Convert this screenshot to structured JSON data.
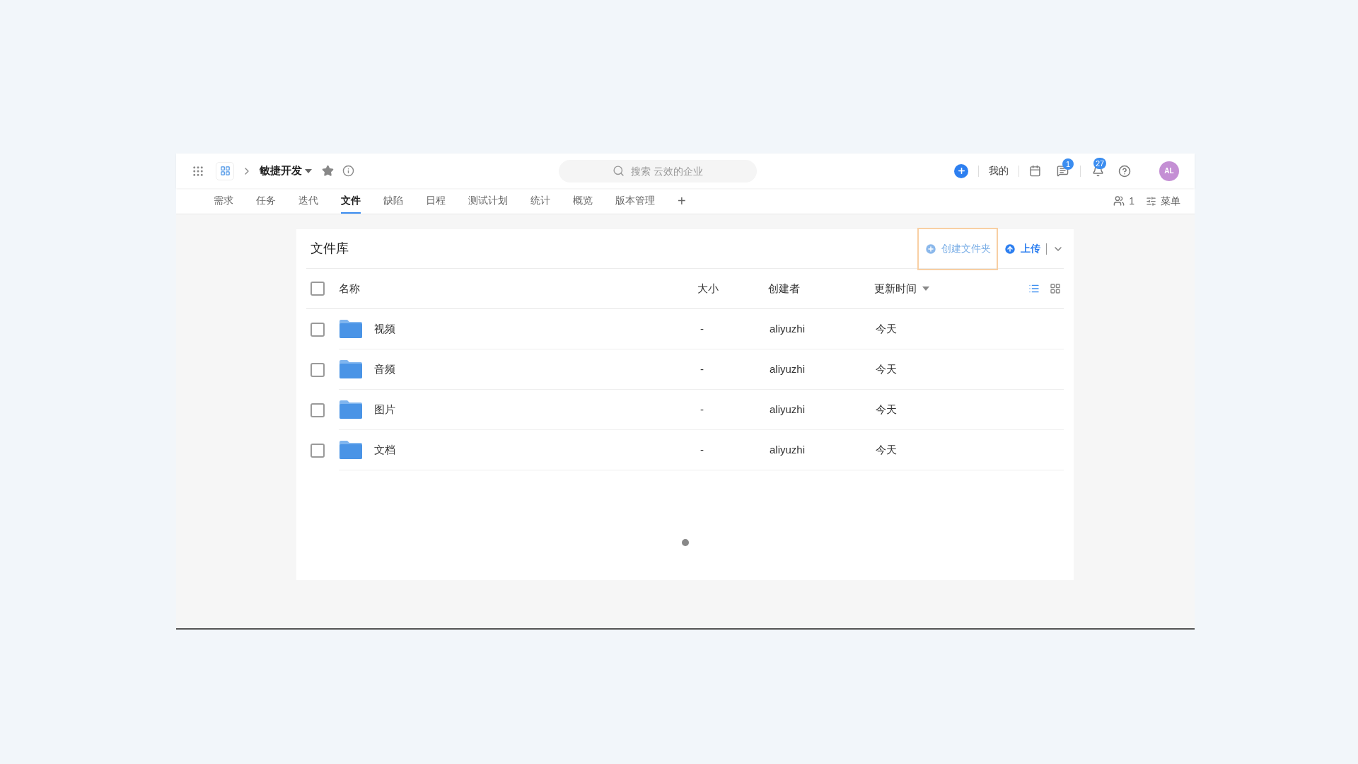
{
  "topbar": {
    "project": "敏捷开发",
    "search": {
      "placeholder": "搜索 云效的企业"
    },
    "mine": "我的",
    "message_badge": "1",
    "notification_badge": "27",
    "avatar": "AL"
  },
  "tabs": [
    {
      "label": "需求",
      "selected": false
    },
    {
      "label": "任务",
      "selected": false
    },
    {
      "label": "迭代",
      "selected": false
    },
    {
      "label": "文件",
      "selected": true
    },
    {
      "label": "缺陷",
      "selected": false
    },
    {
      "label": "日程",
      "selected": false
    },
    {
      "label": "测试计划",
      "selected": false
    },
    {
      "label": "统计",
      "selected": false
    },
    {
      "label": "概览",
      "selected": false
    },
    {
      "label": "版本管理",
      "selected": false
    }
  ],
  "add_tab": "+",
  "members": "1",
  "menu": "菜单",
  "library": {
    "title": "文件库",
    "select_all": {
      "checked": false
    },
    "create_folder": {
      "label": "创建文件夹",
      "highlighted": true
    },
    "upload": "上传",
    "view_modes": [
      {
        "kind": "list",
        "selected": true
      },
      {
        "kind": "grid",
        "selected": false
      }
    ],
    "columns": [
      {
        "label": "名称",
        "sorted": false
      },
      {
        "label": "大小",
        "sorted": false
      },
      {
        "label": "创建者",
        "sorted": false
      },
      {
        "label": "更新时间",
        "sorted": true
      }
    ],
    "rows": [
      {
        "name": "视频",
        "size": "-",
        "creator": "aliyuzhi",
        "updated": "今天",
        "checked": false
      },
      {
        "name": "音频",
        "size": "-",
        "creator": "aliyuzhi",
        "updated": "今天",
        "checked": false
      },
      {
        "name": "图片",
        "size": "-",
        "creator": "aliyuzhi",
        "updated": "今天",
        "checked": false
      },
      {
        "name": "文档",
        "size": "-",
        "creator": "aliyuzhi",
        "updated": "今天",
        "checked": false
      }
    ]
  }
}
